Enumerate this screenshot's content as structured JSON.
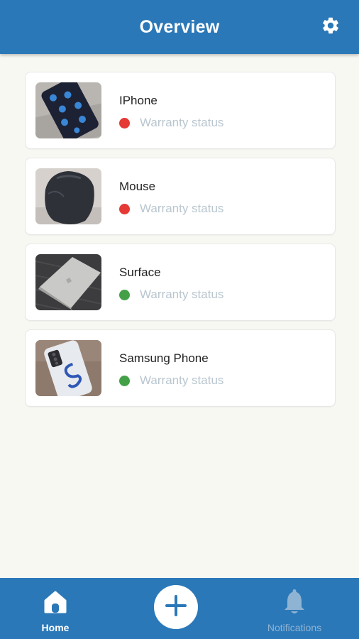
{
  "header": {
    "title": "Overview",
    "settings_icon": "gear-icon"
  },
  "devices": [
    {
      "name": "IPhone",
      "status_label": "Warranty status",
      "status_color": "#e53935",
      "image": "iphone-photo"
    },
    {
      "name": "Mouse",
      "status_label": "Warranty status",
      "status_color": "#e53935",
      "image": "mouse-photo"
    },
    {
      "name": "Surface",
      "status_label": "Warranty status",
      "status_color": "#43a047",
      "image": "surface-photo"
    },
    {
      "name": "Samsung Phone",
      "status_label": "Warranty status",
      "status_color": "#43a047",
      "image": "samsung-phone-photo"
    }
  ],
  "bottom_nav": {
    "home_label": "Home",
    "home_icon": "home-icon",
    "add_icon": "plus-icon",
    "notifications_label": "Notifications",
    "notifications_icon": "bell-icon"
  },
  "colors": {
    "primary": "#2b78b8",
    "background": "#f8f8f3",
    "status_muted_text": "#b9c6cf"
  }
}
